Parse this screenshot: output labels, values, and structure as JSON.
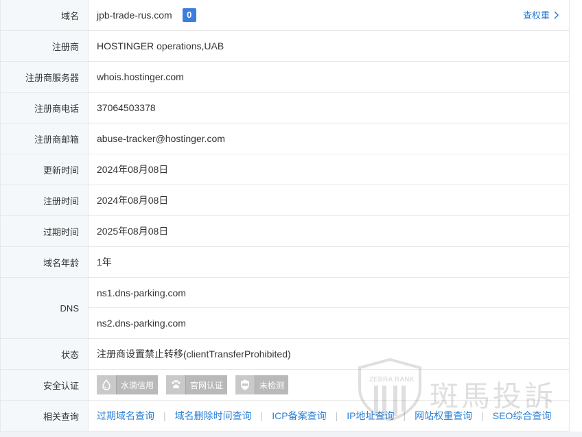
{
  "rows": [
    {
      "label": "域名",
      "value": "jpb-trade-rus.com"
    },
    {
      "label": "注册商",
      "value": "HOSTINGER operations,UAB"
    },
    {
      "label": "注册商服务器",
      "value": "whois.hostinger.com"
    },
    {
      "label": "注册商电话",
      "value": "37064503378"
    },
    {
      "label": "注册商邮箱",
      "value": "abuse-tracker@hostinger.com"
    },
    {
      "label": "更新时间",
      "value": "2024年08月08日"
    },
    {
      "label": "注册时间",
      "value": "2024年08月08日"
    },
    {
      "label": "过期时间",
      "value": "2025年08月08日"
    },
    {
      "label": "域名年龄",
      "value": "1年"
    }
  ],
  "domain_badge": "0",
  "weight_link": "查权重",
  "dns": {
    "label": "DNS",
    "servers": [
      "ns1.dns-parking.com",
      "ns2.dns-parking.com"
    ]
  },
  "status": {
    "label": "状态",
    "value": "注册商设置禁止转移(clientTransferProhibited)"
  },
  "security": {
    "label": "安全认证",
    "certs": [
      {
        "label": "水滴信用",
        "icon": "drop-icon"
      },
      {
        "label": "官网认证",
        "icon": "paw-icon"
      },
      {
        "label": "未检测",
        "icon": "ssl-shield-icon"
      }
    ]
  },
  "related": {
    "label": "相关查询",
    "links": [
      "过期域名查询",
      "域名删除时间查询",
      "ICP备案查询",
      "IP地址查询",
      "网站权重查询",
      "SEO综合查询"
    ]
  },
  "watermark": {
    "brand": "ZEBRA RANK",
    "text": "斑馬投訴"
  },
  "colors": {
    "link": "#2a7fd4",
    "badge": "#3b7ddd",
    "label_bg": "#f5f8fb",
    "border": "#e8e8e8",
    "cert_bg": "#b9b9b9"
  }
}
